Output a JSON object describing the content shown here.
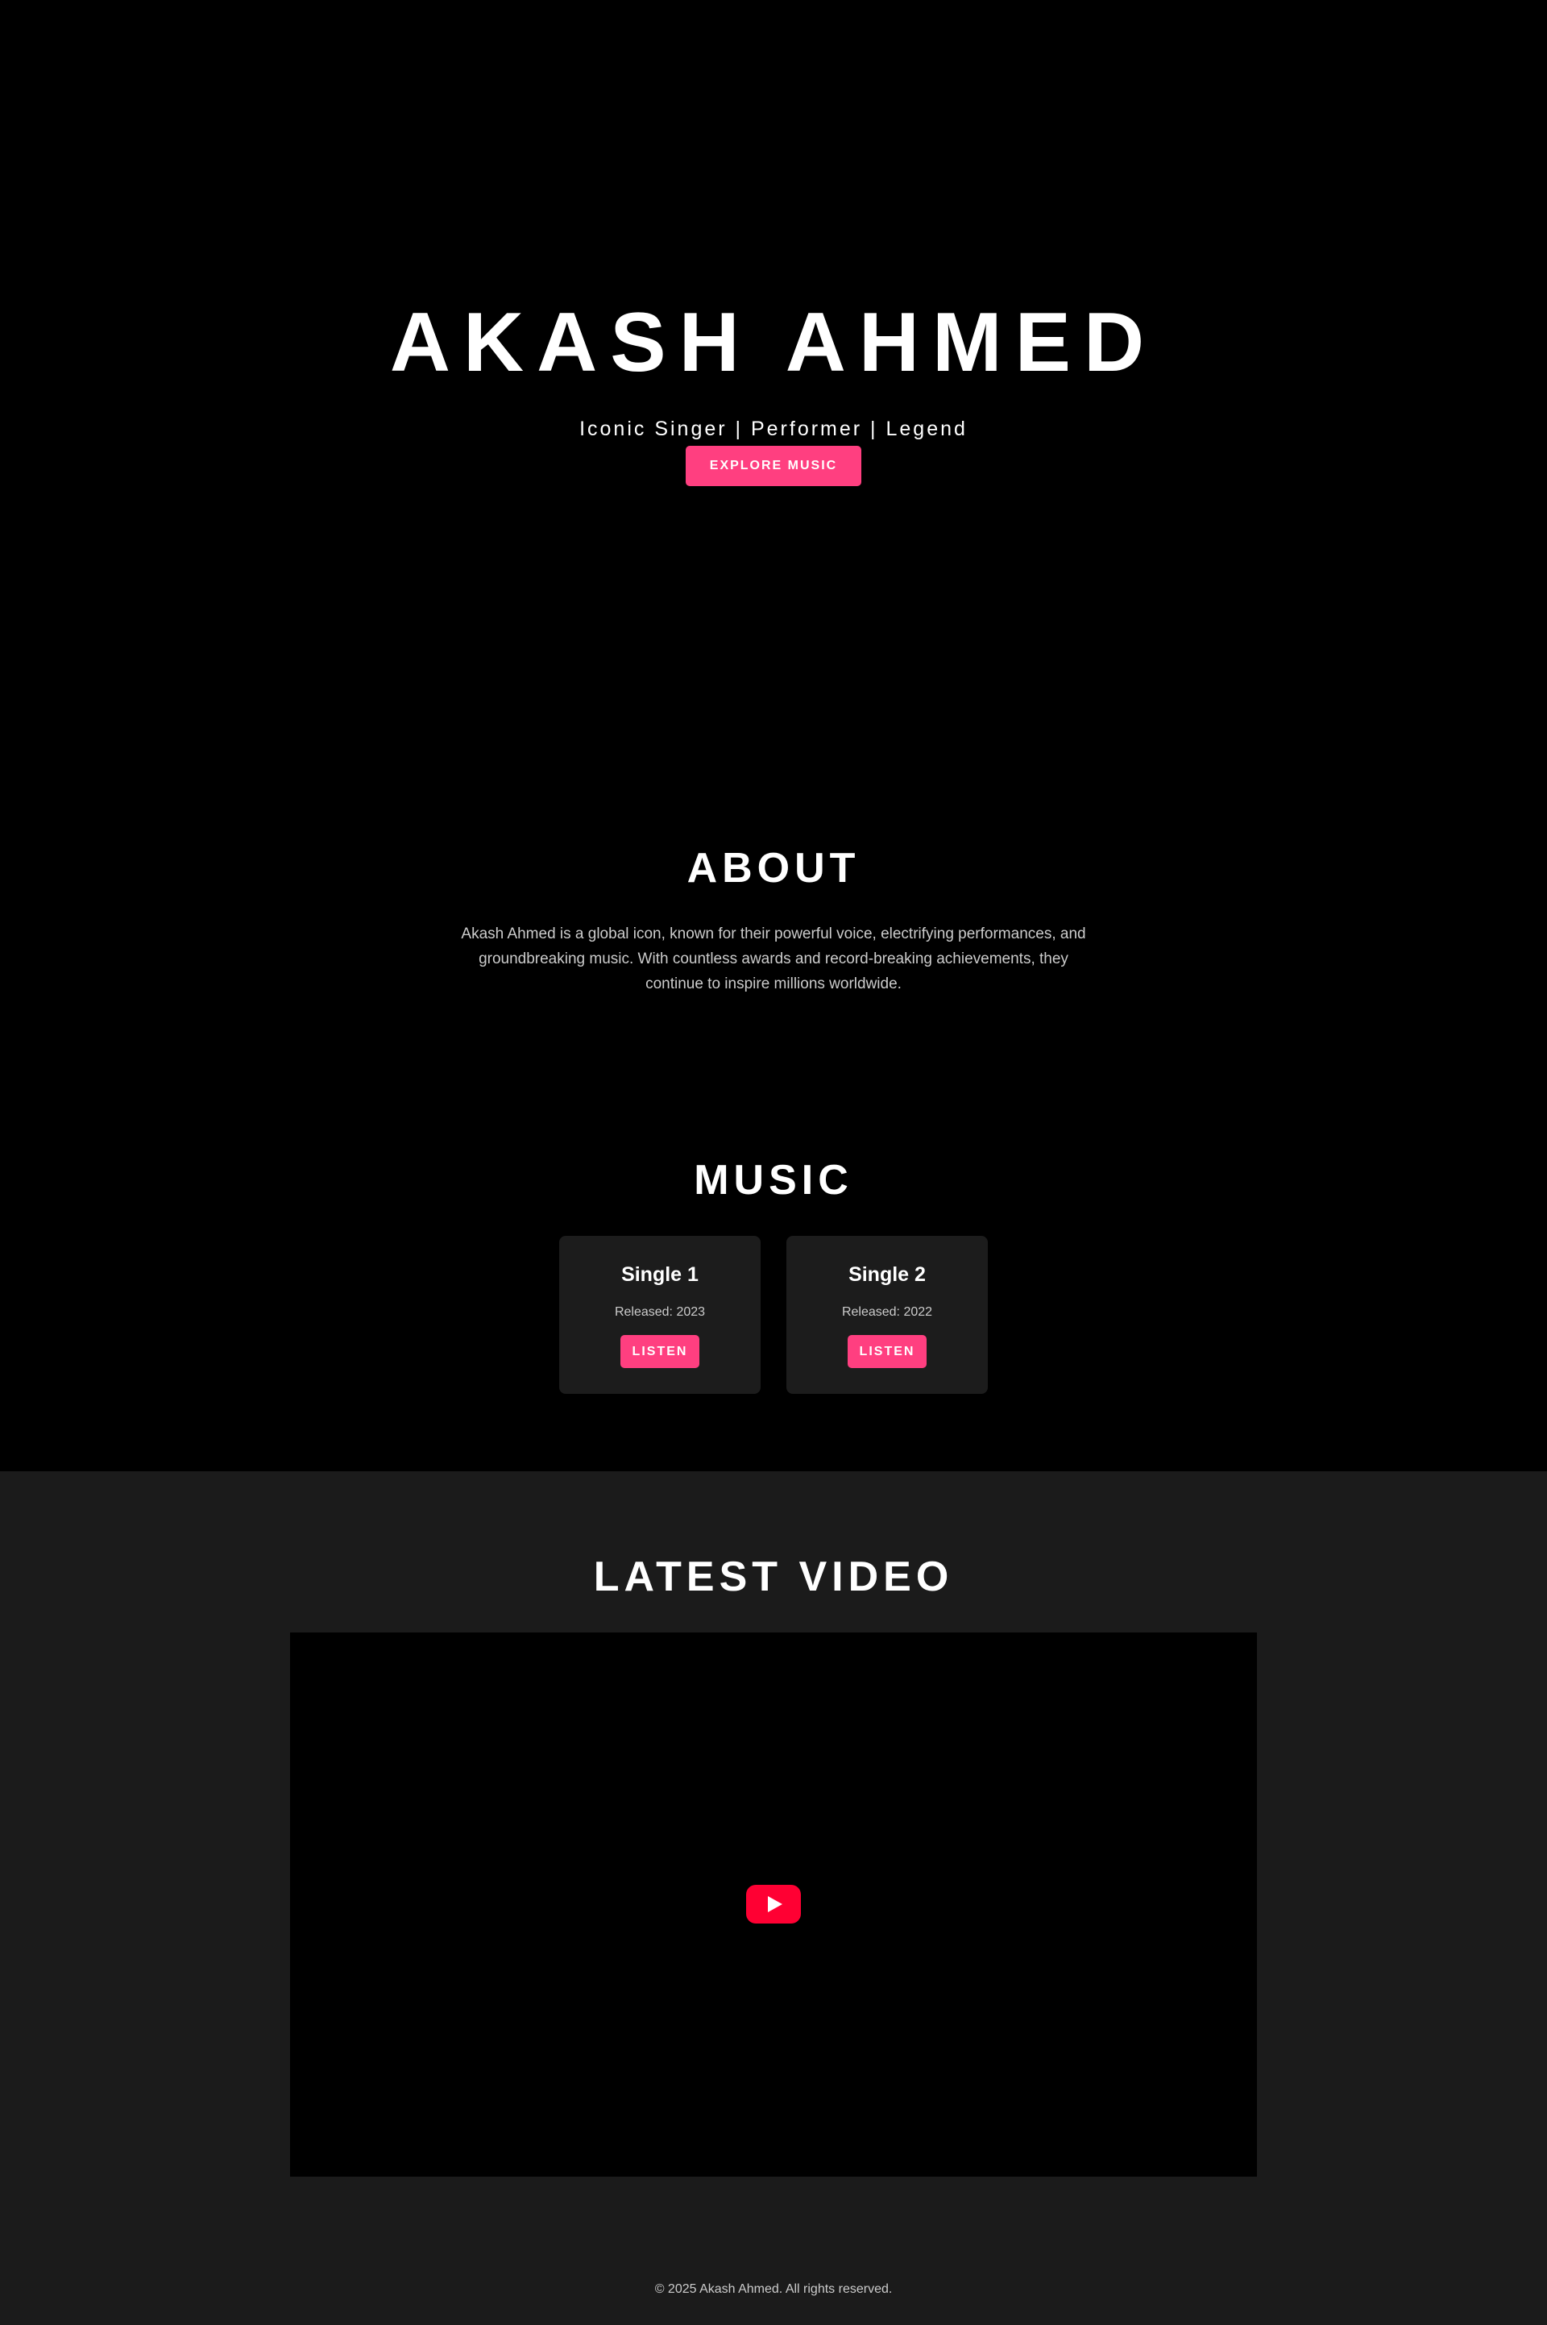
{
  "hero": {
    "title": "AKASH AHMED",
    "subtitle": "Iconic Singer | Performer | Legend",
    "cta_label": "EXPLORE MUSIC"
  },
  "about": {
    "title": "ABOUT",
    "text": "Akash Ahmed is a global icon, known for their powerful voice, electrifying performances, and groundbreaking music. With countless awards and record-breaking achievements, they continue to inspire millions worldwide."
  },
  "music": {
    "title": "MUSIC",
    "singles": [
      {
        "title": "Single 1",
        "released": "Released: 2023",
        "button_label": "LISTEN"
      },
      {
        "title": "Single 2",
        "released": "Released: 2022",
        "button_label": "LISTEN"
      }
    ]
  },
  "video": {
    "title": "LATEST VIDEO",
    "play_icon": "youtube-play-icon"
  },
  "footer": {
    "copyright": "© 2025 Akash Ahmed. All rights reserved."
  },
  "colors": {
    "accent": "#ff3f80",
    "background": "#000000",
    "section_dark": "#1b1b1b",
    "card": "#1c1c1c",
    "youtube_red": "#ff0033"
  }
}
